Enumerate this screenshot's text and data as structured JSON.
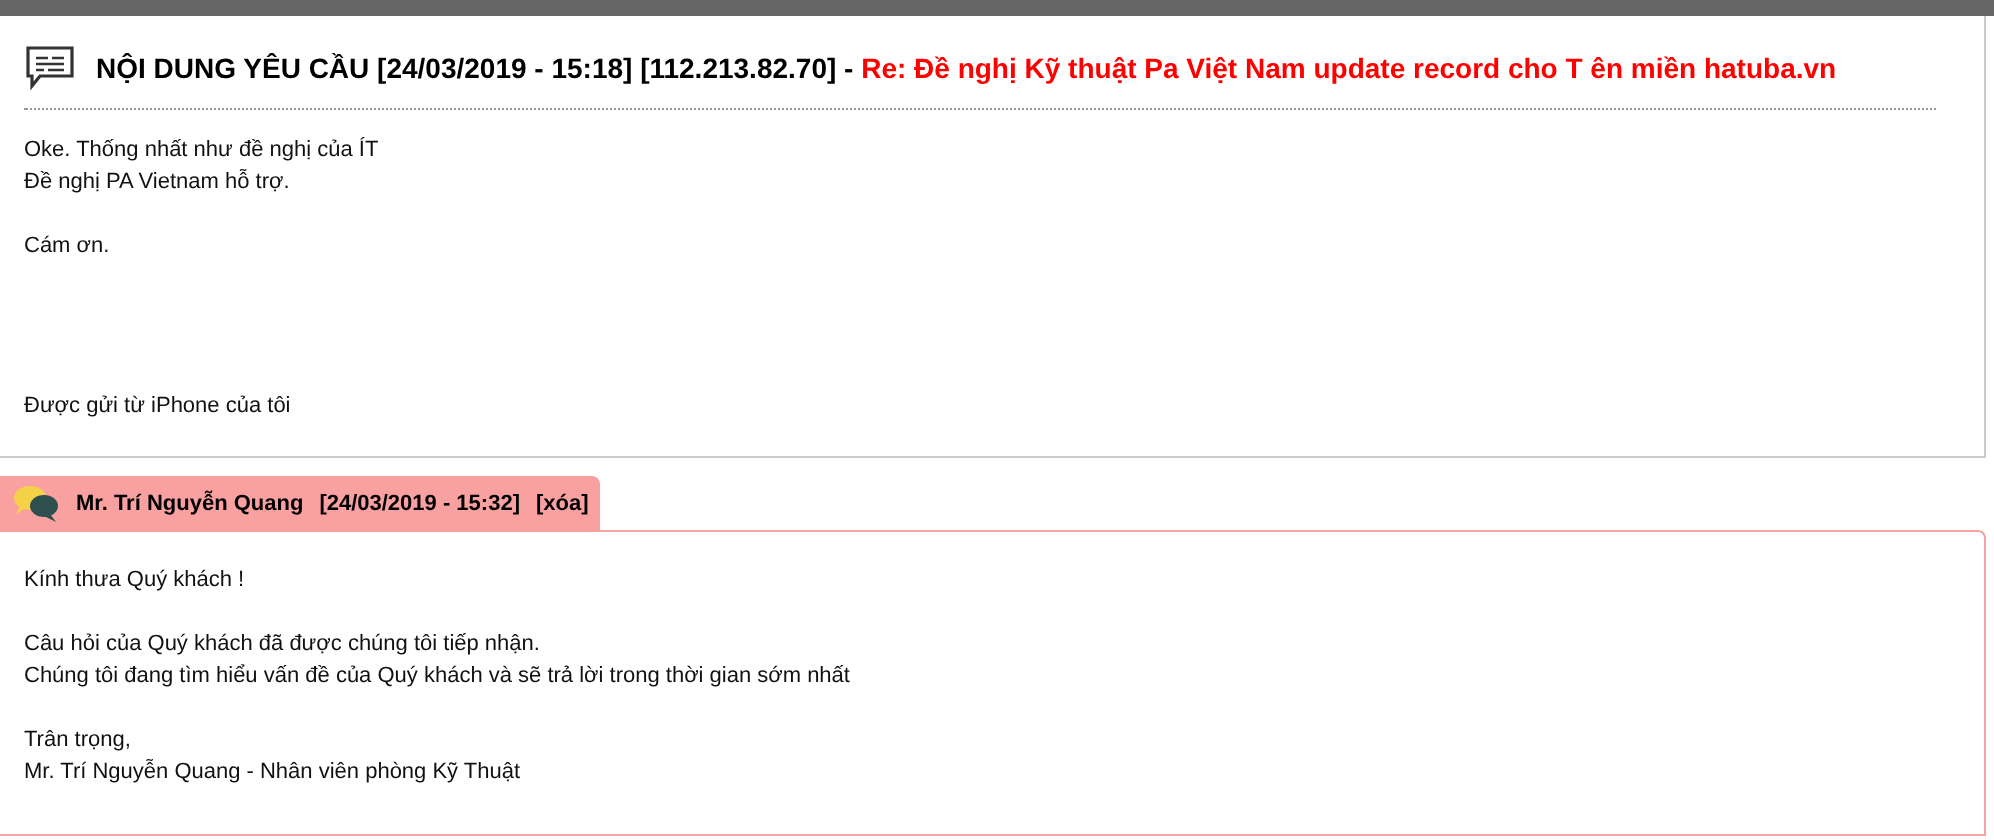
{
  "request": {
    "heading": "NỘI DUNG YÊU CẦU [24/03/2019 - 15:18] [112.213.82.70] -",
    "subject": "Re: Đề nghị Kỹ thuật Pa Việt Nam update record cho T ên miền hatuba.vn",
    "paragraphs": [
      {
        "kind": "text",
        "lines": [
          "Oke. Thống nhất như đề nghị của ÍT",
          "Đề nghị PA Vietnam hỗ trợ."
        ]
      },
      {
        "kind": "text",
        "lines": [
          "Cám ơn."
        ]
      },
      {
        "kind": "signature",
        "lines": [
          "Được gửi từ iPhone của tôi"
        ]
      }
    ]
  },
  "reply": {
    "author": "Mr. Trí Nguyễn Quang",
    "time": "[24/03/2019 - 15:32]",
    "delete_link": "[xóa]",
    "paragraphs": [
      {
        "kind": "text",
        "lines": [
          "Kính thưa Quý khách !"
        ]
      },
      {
        "kind": "text",
        "lines": [
          "Câu hỏi của Quý khách đã được chúng tôi tiếp nhận.",
          "Chúng tôi đang tìm hiểu vấn đề của Quý khách và sẽ trả lời trong thời gian sớm nhất"
        ]
      },
      {
        "kind": "text",
        "lines": [
          "Trân trọng,",
          "Mr. Trí Nguyễn Quang - Nhân viên phòng Kỹ Thuật"
        ]
      }
    ]
  }
}
